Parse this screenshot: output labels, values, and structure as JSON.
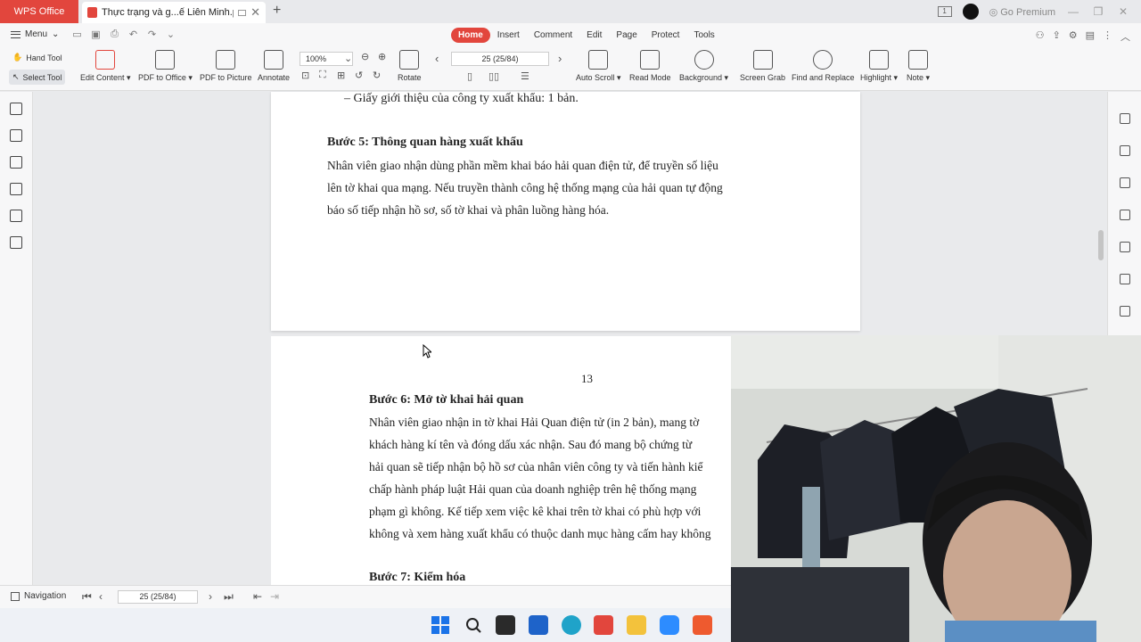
{
  "titlebar": {
    "app_tab": "WPS Office",
    "doc_tab": "Thực trạng và g...ế Liên Minh.pdf",
    "premium": "Go Premium"
  },
  "menu": {
    "menu_label": "Menu",
    "tabs": [
      "Home",
      "Insert",
      "Comment",
      "Edit",
      "Page",
      "Protect",
      "Tools"
    ],
    "active_tab": "Home"
  },
  "toolbar": {
    "hand_tool": "Hand Tool",
    "select_tool": "Select Tool",
    "zoom": "100%",
    "page_indicator": "25 (25/84)",
    "tools": [
      {
        "label": "Edit Content",
        "icon": "edit-content-icon"
      },
      {
        "label": "PDF to Office",
        "icon": "pdf-to-office-icon"
      },
      {
        "label": "PDF to Picture",
        "icon": "pdf-to-picture-icon"
      },
      {
        "label": "Annotate",
        "icon": "annotate-icon"
      },
      {
        "label": "Rotate",
        "icon": "rotate-icon"
      },
      {
        "label": "Auto Scroll",
        "icon": "auto-scroll-icon"
      },
      {
        "label": "Read Mode",
        "icon": "read-mode-icon"
      },
      {
        "label": "Background",
        "icon": "background-icon"
      },
      {
        "label": "Screen Grab",
        "icon": "screen-grab-icon"
      },
      {
        "label": "Find and Replace",
        "icon": "find-replace-icon"
      },
      {
        "label": "Highlight",
        "icon": "highlight-icon"
      },
      {
        "label": "Note",
        "icon": "note-icon"
      }
    ]
  },
  "document": {
    "page1": {
      "bullet": "–   Giấy giới thiệu của công ty xuất khẩu: 1 bản.",
      "heading": "Bước 5: Thông quan hàng xuất khẩu",
      "lines": [
        "Nhân viên giao nhận dùng phần mềm khai báo hải quan điện tử, để truyền số liệu",
        "lên tờ khai qua mạng. Nếu truyền thành công hệ thống mạng của hải quan tự động",
        "báo số tiếp nhận hồ sơ, số tờ khai và phân luồng hàng hóa."
      ]
    },
    "page2": {
      "page_number": "13",
      "heading": "Bước 6: Mở tờ khai hải quan",
      "lines": [
        "Nhân viên giao nhận in tờ khai Hải Quan điện tử (in 2 bản), mang tờ",
        "khách hàng kí tên và đóng dấu xác nhận. Sau đó mang bộ chứng từ",
        "hải quan sẽ tiếp nhận bộ hồ sơ của nhân viên công ty và tiến hành kiể",
        "chấp hành pháp luật Hải quan của doanh nghiệp trên hệ thống mạng",
        "phạm gì không. Kế tiếp xem việc kê khai trên tờ khai có phù hợp với",
        "không và xem hàng xuất khẩu có thuộc danh mục hàng cấm hay không"
      ],
      "heading2": "Bước 7: Kiểm hóa"
    }
  },
  "statusbar": {
    "navigation": "Navigation",
    "page_indicator": "25 (25/84)"
  },
  "colors": {
    "accent": "#e2463d"
  }
}
